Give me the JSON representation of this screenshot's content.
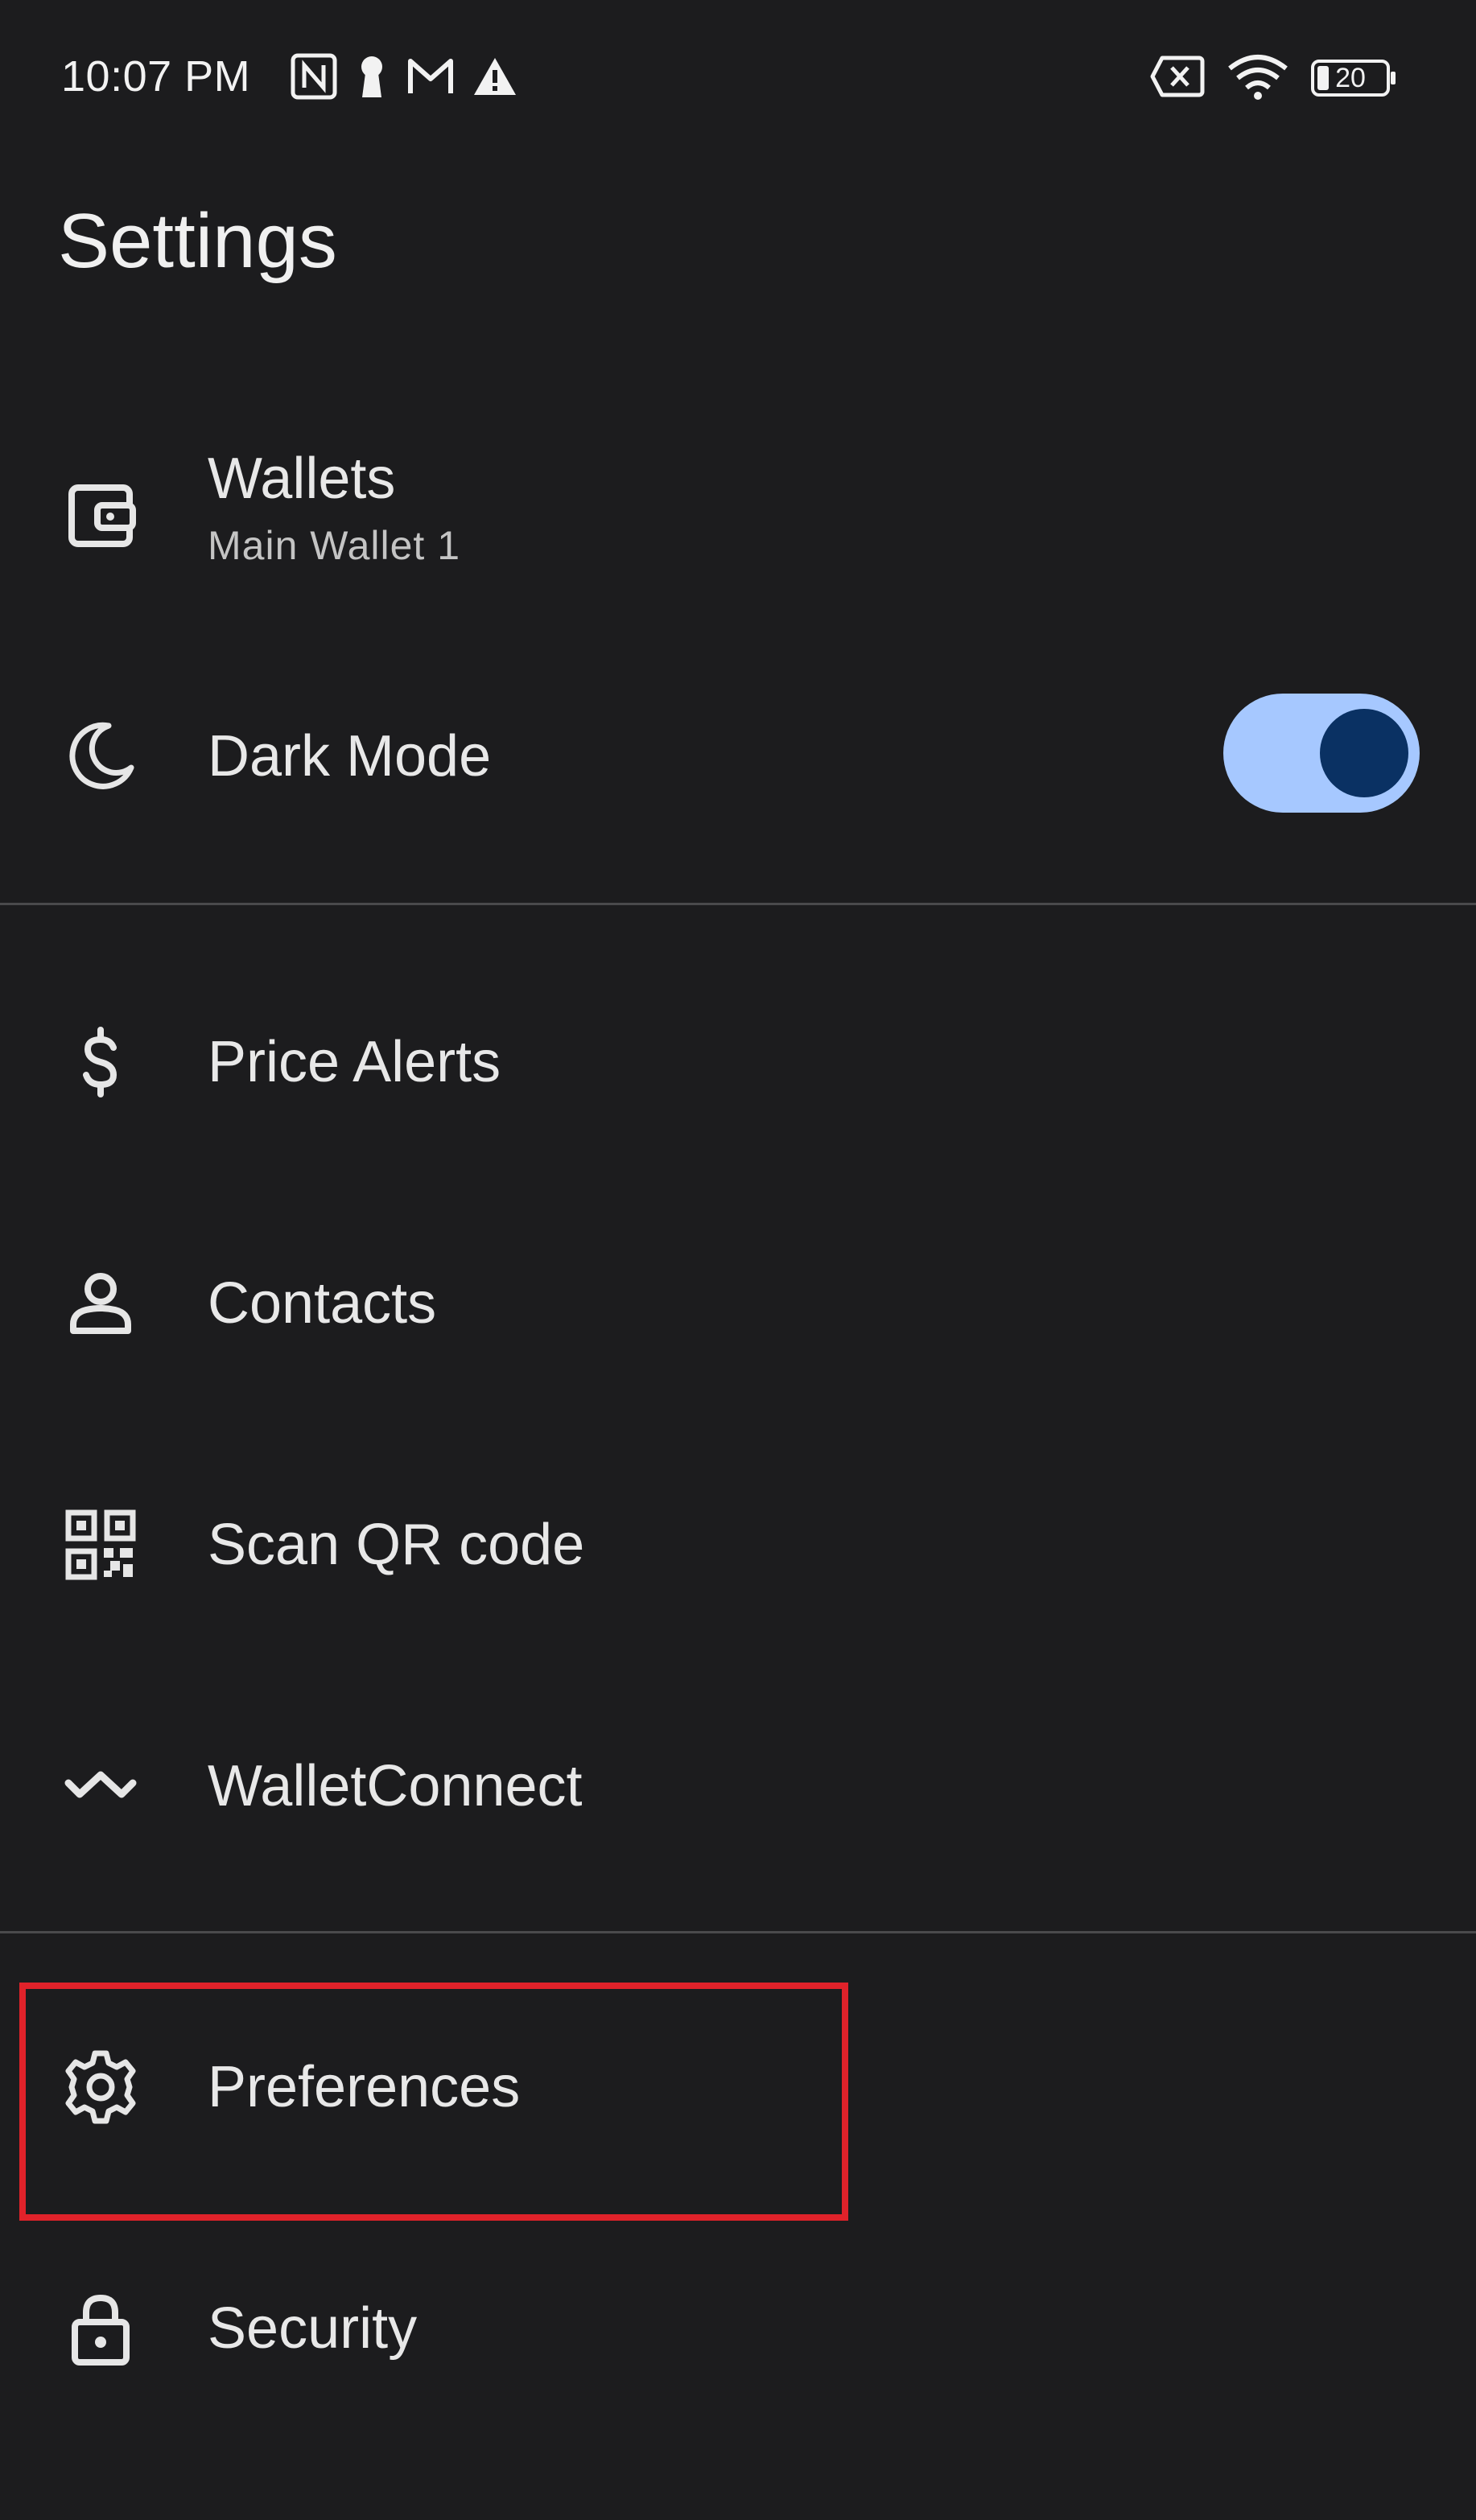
{
  "status_bar": {
    "time": "10:07 PM",
    "left_icons": [
      "nfc-icon",
      "keyhole-icon",
      "gmail-icon",
      "alert-icon"
    ],
    "right_icons": [
      "sim-off-icon",
      "wifi-icon",
      "battery-icon"
    ],
    "battery_level": "20"
  },
  "page": {
    "title": "Settings"
  },
  "items": [
    {
      "label": "Wallets",
      "sublabel": "Main Wallet 1",
      "icon": "wallet-icon"
    },
    {
      "label": "Dark Mode",
      "icon": "moon-icon",
      "toggle_on": true
    },
    {
      "label": "Price Alerts",
      "icon": "dollar-icon"
    },
    {
      "label": "Contacts",
      "icon": "person-icon"
    },
    {
      "label": "Scan QR code",
      "icon": "qr-code-icon"
    },
    {
      "label": "WalletConnect",
      "icon": "walletconnect-icon"
    },
    {
      "label": "Preferences",
      "icon": "gear-icon",
      "highlighted": true
    },
    {
      "label": "Security",
      "icon": "lock-icon"
    }
  ],
  "colors": {
    "background": "#1c1c1e",
    "toggle_track": "#a6c8ff",
    "toggle_knob": "#0a3163",
    "highlight": "#e0222a"
  }
}
